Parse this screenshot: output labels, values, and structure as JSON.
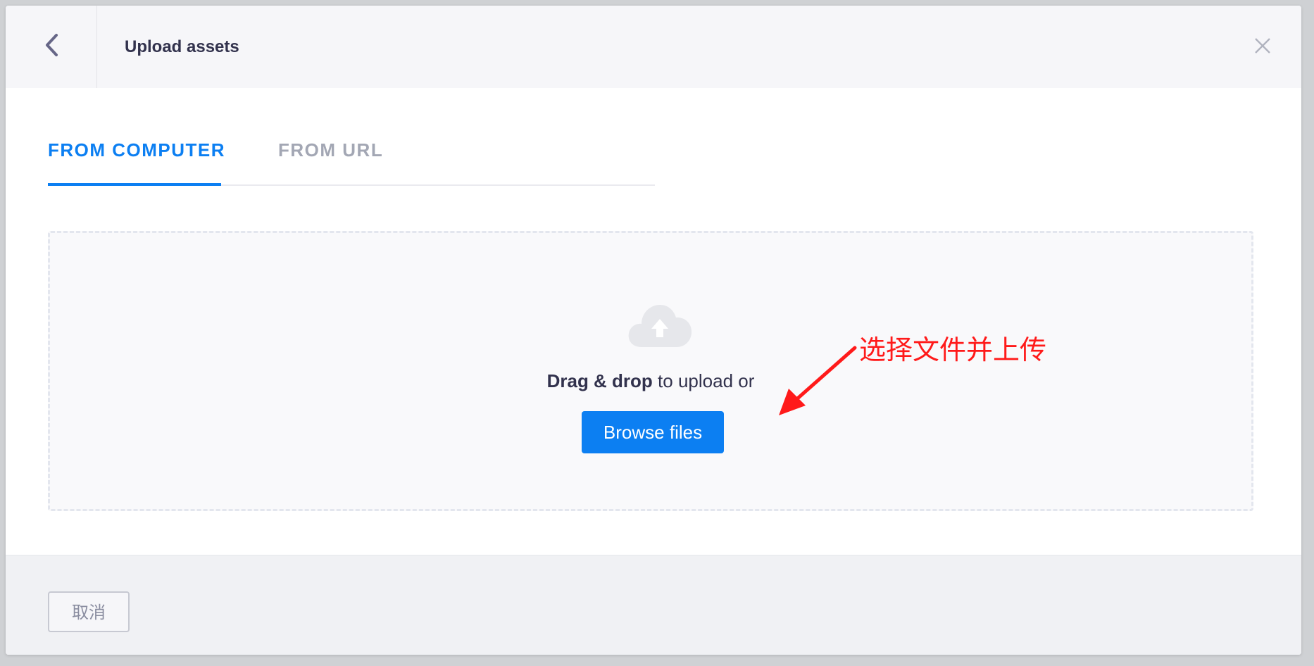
{
  "header": {
    "back_icon": "chevron-left-icon",
    "title": "Upload assets",
    "close_icon": "close-icon"
  },
  "tabs": [
    {
      "label": "FROM COMPUTER",
      "active": true
    },
    {
      "label": "FROM URL",
      "active": false
    }
  ],
  "dropzone": {
    "icon": "cloud-upload-icon",
    "text_bold": "Drag & drop",
    "text_rest": " to upload or",
    "browse_label": "Browse files"
  },
  "annotation": {
    "text": "选择文件并上传",
    "color": "#ff1a1a"
  },
  "footer": {
    "cancel_label": "取消"
  },
  "colors": {
    "accent": "#0c7ff2",
    "title": "#32324d",
    "muted": "#a3a7b4"
  }
}
